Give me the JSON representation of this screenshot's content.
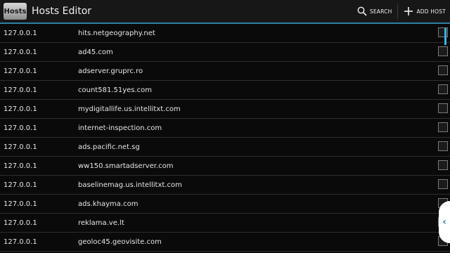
{
  "app": {
    "icon_text": "Hosts",
    "title": "Hosts Editor"
  },
  "actions": {
    "search_label": "SEARCH",
    "add_label": "ADD HOST"
  },
  "entries": [
    {
      "ip": "127.0.0.1",
      "host": "hits.netgeography.net",
      "checked": false
    },
    {
      "ip": "127.0.0.1",
      "host": "ad45.com",
      "checked": false
    },
    {
      "ip": "127.0.0.1",
      "host": "adserver.gruprc.ro",
      "checked": false
    },
    {
      "ip": "127.0.0.1",
      "host": "count581.51yes.com",
      "checked": false
    },
    {
      "ip": "127.0.0.1",
      "host": "mydigitallife.us.intellitxt.com",
      "checked": false
    },
    {
      "ip": "127.0.0.1",
      "host": "internet-inspection.com",
      "checked": false
    },
    {
      "ip": "127.0.0.1",
      "host": "ads.pacific.net.sg",
      "checked": false
    },
    {
      "ip": "127.0.0.1",
      "host": "ww150.smartadserver.com",
      "checked": false
    },
    {
      "ip": "127.0.0.1",
      "host": "baselinemag.us.intellitxt.com",
      "checked": false
    },
    {
      "ip": "127.0.0.1",
      "host": "ads.khayma.com",
      "checked": false
    },
    {
      "ip": "127.0.0.1",
      "host": "reklama.ve.lt",
      "checked": false
    },
    {
      "ip": "127.0.0.1",
      "host": "geoloc45.geovisite.com",
      "checked": false
    }
  ],
  "colors": {
    "accent": "#33b5e5",
    "divider": "#2c7fa3",
    "background": "#0a0a0a"
  },
  "icons": {
    "search": "search-icon",
    "add": "plus-icon",
    "drawer": "chevron-left-icon"
  }
}
